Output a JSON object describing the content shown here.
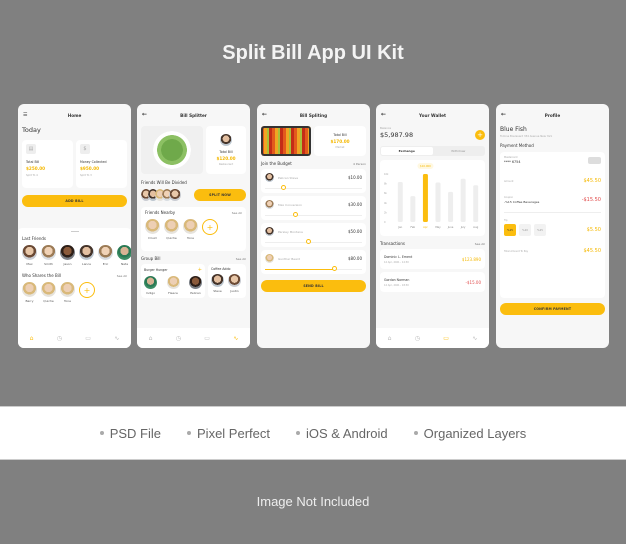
{
  "banner": {
    "title": "Split Bill App UI Kit",
    "features": [
      "PSD File",
      "Pixel Perfect",
      "iOS & Android",
      "Organized Layers"
    ],
    "footer_note": "Image Not Included"
  },
  "accent_color": "#fbbd0e",
  "negative_color": "#e04b4b",
  "screens": {
    "home": {
      "header": "Home",
      "menu_icon": "hamburger-icon",
      "today": "Today",
      "cards": [
        {
          "icon": "document-icon",
          "label": "Total Bill",
          "amount": "$250.00",
          "sub": "Split To 4"
        },
        {
          "icon": "dollar-icon",
          "label": "Money Collected",
          "amount": "$950.00",
          "sub": "Split To 3"
        }
      ],
      "add_bill": "ADD BILL",
      "last_friends_title": "Last Friends",
      "last_friends": [
        "Max",
        "Smith",
        "Jason",
        "Lance",
        "Eric",
        "Nata"
      ],
      "shares_title": "Who Shares the Bill",
      "see_all": "See All",
      "shares": [
        "Barry",
        "Quiche",
        "Tone"
      ],
      "nav": [
        "home-icon",
        "clock-icon",
        "calendar-icon",
        "activity-icon"
      ],
      "nav_active": 0
    },
    "splitter": {
      "header": "Bill Splitter",
      "total_label": "Total Bill",
      "total_amount": "$120.00",
      "total_sub": "Restaurant",
      "divided_title": "Friends Will Be Divided",
      "split_now": "SPLIT NOW",
      "nearby_title": "Friends Nearby",
      "see_all": "See All",
      "nearby": [
        "Druid",
        "Quiche",
        "Tone"
      ],
      "group_title": "Group Bill",
      "groups": [
        {
          "name": "Burger Hunger",
          "members": [
            "Indigo",
            "Fleece",
            "Pelican"
          ]
        },
        {
          "name": "Coffee Addo",
          "members": [
            "Steve",
            "Justin"
          ]
        }
      ],
      "nav_active": 3
    },
    "splitting": {
      "header": "Bill Spliting",
      "total_label": "Total Bill",
      "total_amount": "$170.00",
      "total_sub": "Market",
      "budget_title": "Join the Budget",
      "person_count": "4 Person",
      "people": [
        {
          "name": "Pelican Steve",
          "amount": "$10.00",
          "share": 0.2
        },
        {
          "name": "Max Conversion",
          "amount": "$30.00",
          "share": 0.32
        },
        {
          "name": "Parsley Montana",
          "amount": "$50.00",
          "share": 0.45
        },
        {
          "name": "Gunther Beard",
          "amount": "$80.00",
          "share": 0.72
        }
      ],
      "send_bill": "SEND BILL"
    },
    "wallet": {
      "header": "Your Wallet",
      "balance_label": "Balance",
      "balance": "$5,987.98",
      "tabs": [
        "Exchange",
        "Withdraw"
      ],
      "active_tab": 0,
      "transactions_title": "Transactions",
      "see_all": "See All",
      "transactions": [
        {
          "name": "Dominic L. Ement",
          "date": "12 Apr, 2021 - 12:30",
          "amount": "$123.890",
          "type": "positive"
        },
        {
          "name": "Gordon Norman",
          "date": "12 Apr, 2021 - 18:30",
          "amount": "-$15.00",
          "type": "negative"
        }
      ],
      "nav_active": 2
    },
    "profile": {
      "header": "Profile",
      "name": "Blue Fish",
      "address": "Tomine Boulevard 334 Avenue New York",
      "payment_title": "Payment Method",
      "card_label": "Mastercard",
      "card_number": "**** 6754",
      "amount_label": "Amount",
      "amount": "$45.50",
      "coupon_label": "Coupon",
      "coupon_name": "-%15 Coffee Beverages",
      "coupon_amount": "-$15.50",
      "tip_label": "Tip",
      "tip_options": [
        "%15",
        "%20",
        "%25"
      ],
      "tip_selected": 0,
      "tip_amount": "$5.50",
      "total_label": "Total Amount To Pay",
      "total": "$45.50",
      "confirm": "CONFIRM PAYMENT"
    }
  },
  "chart_data": {
    "type": "bar",
    "title": "",
    "categories": [
      "Jan",
      "Feb",
      "Apr",
      "May",
      "June",
      "July",
      "Aug"
    ],
    "values": [
      85,
      55,
      102,
      84,
      64,
      92,
      78
    ],
    "highlight_index": 2,
    "highlight_label": "$10.000",
    "y_ticks": [
      "0",
      "2k",
      "4k",
      "6k",
      "8k",
      "10k"
    ],
    "ylim": [
      0,
      100
    ],
    "xlabel": "",
    "ylabel": "",
    "grid": false
  }
}
